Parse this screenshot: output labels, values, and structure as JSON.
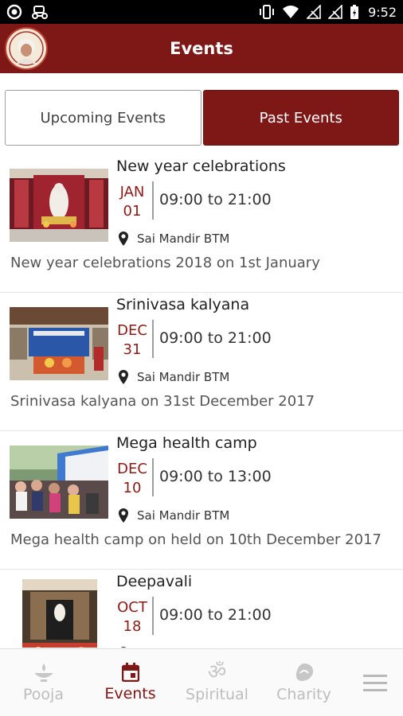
{
  "status_bar": {
    "time": "9:52",
    "left_icons": [
      "notification-circle-icon",
      "ride-icon"
    ],
    "right_icons": [
      "vibrate-icon",
      "wifi-icon",
      "no-signal-icon",
      "no-signal-icon",
      "battery-charging-icon"
    ]
  },
  "app_bar": {
    "title": "Events",
    "logo": "sai-baba-logo"
  },
  "tabs": [
    {
      "label": "Upcoming Events",
      "selected": false
    },
    {
      "label": "Past Events",
      "selected": true
    }
  ],
  "events": [
    {
      "title": "New year celebrations",
      "month": "JAN",
      "day": "01",
      "time": "09:00 to 21:00",
      "location": "Sai Mandir BTM",
      "description": "New year celebrations 2018 on 1st January"
    },
    {
      "title": "Srinivasa kalyana",
      "month": "DEC",
      "day": "31",
      "time": "09:00 to 21:00",
      "location": "Sai Mandir BTM",
      "description": "Srinivasa kalyana on 31st December 2017"
    },
    {
      "title": "Mega health camp",
      "month": "DEC",
      "day": "10",
      "time": "09:00 to 13:00",
      "location": "Sai Mandir BTM",
      "description": "Mega health camp on held on 10th December 2017"
    },
    {
      "title": "Deepavali",
      "month": "OCT",
      "day": "18",
      "time": "09:00 to 21:00",
      "location": "",
      "description": ""
    }
  ],
  "bottom_nav": {
    "items": [
      {
        "label": "Pooja",
        "icon": "diya-icon",
        "active": false
      },
      {
        "label": "Events",
        "icon": "calendar-icon",
        "active": true
      },
      {
        "label": "Spiritual",
        "icon": "om-icon",
        "active": false
      },
      {
        "label": "Charity",
        "icon": "charity-icon",
        "active": false
      }
    ],
    "menu_icon": "hamburger-menu-icon"
  },
  "colors": {
    "primary": "#7e1816",
    "inactive": "#bdbdbd",
    "date": "#8a1b17"
  }
}
